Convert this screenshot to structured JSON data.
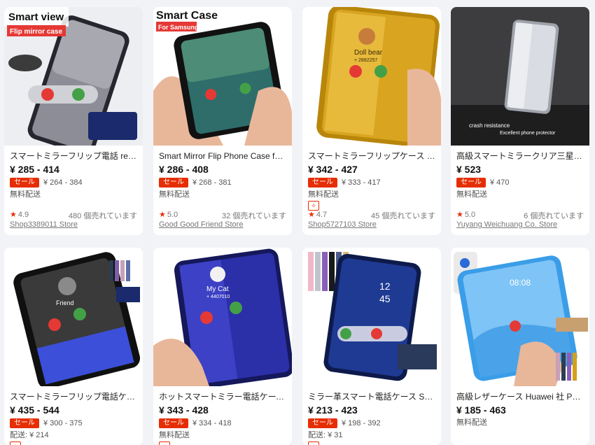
{
  "products": [
    {
      "title": "スマートミラーフリップ電話 redmi...",
      "price": "¥ 285 - 414",
      "sale_label": "セール",
      "orig_price": "¥ 264 - 384",
      "shipping": "無料配送",
      "choice_icon": "choice-badge-icon",
      "rating": "4.9",
      "sold": "480 個売れています",
      "store": "Shop3389011 Store",
      "image_caption_1": "Smart view",
      "image_caption_2": "Flip mirror case",
      "colors": {
        "bg": "#e9e9ec",
        "phone": "#2b2b33"
      }
    },
    {
      "title": "Smart Mirror Flip Phone Case for X...",
      "price": "¥ 286 - 408",
      "sale_label": "セール",
      "orig_price": "¥ 268 - 381",
      "shipping": "無料配送",
      "rating": "5.0",
      "sold": "32 個売れています",
      "store": "Good Good Friend Store",
      "image_caption_1": "Smart Case",
      "image_caption_2": "For Samsung",
      "colors": {
        "bg": "#ffffff",
        "phone": "#111111"
      }
    },
    {
      "title": "スマートミラーフリップケース xiao...",
      "price": "¥ 342 - 427",
      "sale_label": "セール",
      "orig_price": "¥ 333 - 417",
      "shipping": "無料配送",
      "rating": "4.7",
      "sold": "45 個売れています",
      "store": "Shop5727103 Store",
      "image_caption_1": "Doll bear",
      "image_caption_2": "+ 2882257",
      "colors": {
        "bg": "#ffffff",
        "phone": "#d4a017"
      }
    },
    {
      "title": "高級スマートミラークリア三星銀河...",
      "price": "¥ 523",
      "sale_label": "セール",
      "orig_price": "¥ 470",
      "shipping": "無料配送",
      "rating": "5.0",
      "sold": "6 個売れています",
      "store": "Yuyang Weichuang Co. Store",
      "image_caption_1": "crash resistance",
      "image_caption_2": "Excellent phone protector",
      "colors": {
        "bg": "#3a3a3a",
        "phone": "#b8bcc4"
      }
    },
    {
      "title": "スマートミラーフリップ電話ケース...",
      "price": "¥ 435 - 544",
      "sale_label": "セール",
      "orig_price": "¥ 300 - 375",
      "shipping": "配送: ¥ 214",
      "image_caption_1": "Friend",
      "colors": {
        "bg": "#ffffff",
        "phone": "#111111"
      }
    },
    {
      "title": "ホットスマートミラー電話ケース h...",
      "price": "¥ 343 - 428",
      "sale_label": "セール",
      "orig_price": "¥ 334 - 418",
      "shipping": "無料配送",
      "image_caption_1": "My Cat",
      "image_caption_2": "+ 4407010",
      "colors": {
        "bg": "#ffffff",
        "phone": "#2b2fa8"
      }
    },
    {
      "title": "ミラー革スマート電話ケース S10 S...",
      "price": "¥ 213 - 423",
      "sale_label": "セール",
      "orig_price": "¥ 198 - 392",
      "shipping": "配送: ¥ 31",
      "image_caption_1": "12",
      "image_caption_2": "45",
      "colors": {
        "bg": "#ffffff",
        "phone": "#1f3a93"
      }
    },
    {
      "title": "高級レザーケース Huawei 社 P30 P...",
      "price": "¥ 185 - 463",
      "shipping": "無料配送",
      "image_caption_1": "08:08",
      "colors": {
        "bg": "#ffffff",
        "phone": "#4aa3e8"
      }
    }
  ]
}
